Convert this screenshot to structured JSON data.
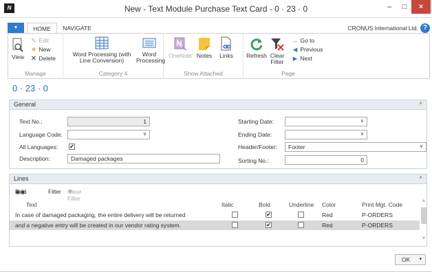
{
  "window": {
    "title": "New - Text Module Purchase Text Card - 0 · 23 · 0",
    "logo": "N",
    "minimize": "–",
    "maximize": "□",
    "close": "×"
  },
  "ribbon_tabs": {
    "menu_icon": "▼",
    "home": "HOME",
    "navigate": "NAVIGATE",
    "company": "CRONUS International Ltd.",
    "help": "?"
  },
  "ribbon": {
    "manage": {
      "label": "Manage",
      "view": "View",
      "edit": "Edit",
      "new": "New",
      "delete": "Delete"
    },
    "category4": {
      "label": "Category 4",
      "word_conv_line1": "Word Processing (with",
      "word_conv_line2": "Line Conversion)",
      "word_proc_line1": "Word",
      "word_proc_line2": "Processing"
    },
    "show_attached": {
      "label": "Show Attached",
      "onenote": "OneNote",
      "notes": "Notes",
      "links": "Links"
    },
    "page": {
      "label": "Page",
      "refresh": "Refresh",
      "clear_filter_line1": "Clear",
      "clear_filter_line2": "Filter",
      "go_to": "Go to",
      "previous": "Previous",
      "next": "Next"
    }
  },
  "record_caption": "0 · 23 · 0",
  "general": {
    "title": "General",
    "chevron": "˄",
    "text_no_label": "Text No.:",
    "text_no_value": "1",
    "language_code_label": "Language Code:",
    "language_code_value": "",
    "all_languages_label": "All Languages:",
    "all_languages_checked": "✔",
    "description_label": "Description:",
    "description_value": "Damaged packages",
    "starting_date_label": "Starting Date:",
    "starting_date_value": "",
    "ending_date_label": "Ending Date:",
    "ending_date_value": "",
    "header_footer_label": "Header/Footer:",
    "header_footer_value": "Footer",
    "sorting_no_label": "Sorting No.:",
    "sorting_no_value": "0",
    "dropdown_glyph": "∨"
  },
  "lines": {
    "title": "Lines",
    "chevron": "˄",
    "find": "Find",
    "filter": "Filter",
    "clear_filter": "Clear Filter",
    "columns": {
      "text": "Text",
      "italic": "Italic",
      "bold": "Bold",
      "underline": "Underline",
      "color": "Color",
      "print_mgt_code": "Print Mgt. Code"
    },
    "rows": [
      {
        "text": "In case of damaged packaging, the entire delivery will be returned",
        "italic": "",
        "bold": "✔",
        "underline": "",
        "color": "Red",
        "print_mgt_code": "P-ORDERS"
      },
      {
        "text": "and a negative entry will be created in our vendor rating system.",
        "italic": "",
        "bold": "✔",
        "underline": "",
        "color": "Red",
        "print_mgt_code": "P-ORDERS"
      }
    ],
    "scroll_up": "˄",
    "scroll_down": "˅"
  },
  "footer": {
    "ok": "OK",
    "ok_dropdown": "▾"
  },
  "colors": {
    "accent": "#1d74c8",
    "close": "#c9463d",
    "panel_header": "#e8ecf1",
    "selected_row": "#d9d9d9"
  }
}
